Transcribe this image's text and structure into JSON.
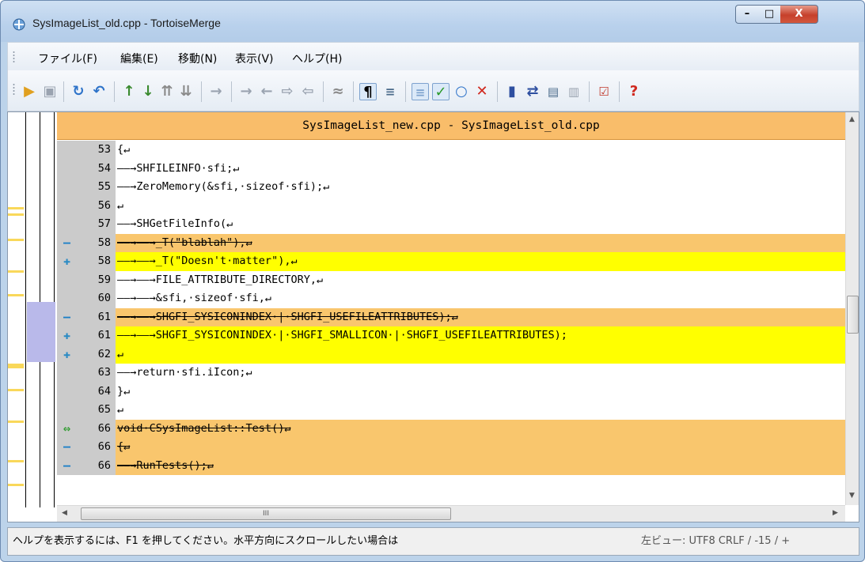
{
  "window": {
    "title": "SysImageList_old.cpp - TortoiseMerge",
    "min_label": "–",
    "max_label": "□",
    "close_label": "X"
  },
  "menu": [
    {
      "label": "ファイル(F)"
    },
    {
      "label": "編集(E)"
    },
    {
      "label": "移動(N)"
    },
    {
      "label": "表示(V)"
    },
    {
      "label": "ヘルプ(H)"
    }
  ],
  "toolbar_icons": [
    "open-icon",
    "save-icon",
    "reload-icon",
    "undo-icon",
    "prev-diff-icon",
    "next-diff-icon",
    "prev-conflict-icon",
    "next-conflict-icon",
    "inline-prev-icon",
    "inline-next-icon",
    "prev-change-icon",
    "next-change-icon",
    "prev-inline-icon",
    "collapse-icon",
    "whitespace-icon",
    "wrap-icon",
    "one-pane-icon",
    "use-theirs-icon",
    "use-mine-icon",
    "remove-icon",
    "two-pane-icon",
    "switch-icon",
    "patch-icon",
    "blank-icon",
    "mark-resolved-icon",
    "help-icon"
  ],
  "view_title": "SysImageList_new.cpp - SysImageList_old.cpp",
  "lines": [
    {
      "num": "53",
      "state": "normal",
      "marker": "",
      "text": "{↵"
    },
    {
      "num": "54",
      "state": "normal",
      "marker": "",
      "text": "——→SHFILEINFO·sfi;↵"
    },
    {
      "num": "55",
      "state": "normal",
      "marker": "",
      "text": "——→ZeroMemory(&sfi,·sizeof·sfi);↵"
    },
    {
      "num": "56",
      "state": "normal",
      "marker": "",
      "text": "↵"
    },
    {
      "num": "57",
      "state": "normal",
      "marker": "",
      "text": "——→SHGetFileInfo(↵"
    },
    {
      "num": "58",
      "state": "removed",
      "marker": "—",
      "text": "——→——→_T(\"blablah\"),↵"
    },
    {
      "num": "58",
      "state": "added",
      "marker": "✚",
      "text": "——→——→_T(\"Doesn't·matter\"),↵"
    },
    {
      "num": "59",
      "state": "normal",
      "marker": "",
      "text": "——→——→FILE_ATTRIBUTE_DIRECTORY,↵"
    },
    {
      "num": "60",
      "state": "normal",
      "marker": "",
      "text": "——→——→&sfi,·sizeof·sfi,↵"
    },
    {
      "num": "61",
      "state": "removed",
      "marker": "—",
      "text": "——→——→SHGFI_SYSICONINDEX·|·SHGFI_USEFILEATTRIBUTES);↵"
    },
    {
      "num": "61",
      "state": "added",
      "marker": "✚",
      "text": "——→——→SHGFI_SYSICONINDEX·|·SHGFI_SMALLICON·|·SHGFI_USEFILEATTRIBUTES);"
    },
    {
      "num": "62",
      "state": "added",
      "marker": "✚",
      "text": "↵"
    },
    {
      "num": "63",
      "state": "normal",
      "marker": "",
      "text": "——→return·sfi.iIcon;↵"
    },
    {
      "num": "64",
      "state": "normal",
      "marker": "",
      "text": "}↵"
    },
    {
      "num": "65",
      "state": "normal",
      "marker": "",
      "text": "↵"
    },
    {
      "num": "66",
      "state": "moved",
      "marker": "⇔",
      "text": "void·CSysImageList::Test()↵"
    },
    {
      "num": "66",
      "state": "removed",
      "marker": "—",
      "text": "{↵"
    },
    {
      "num": "66",
      "state": "removed",
      "marker": "—",
      "text": "——→RunTests();↵"
    }
  ],
  "hscroll_label": "III",
  "status": {
    "help": "ヘルプを表示するには、F1 を押してください。水平方向にスクロールしたい場合は",
    "right": "左ビュー: UTF8 CRLF / -15 / +"
  }
}
